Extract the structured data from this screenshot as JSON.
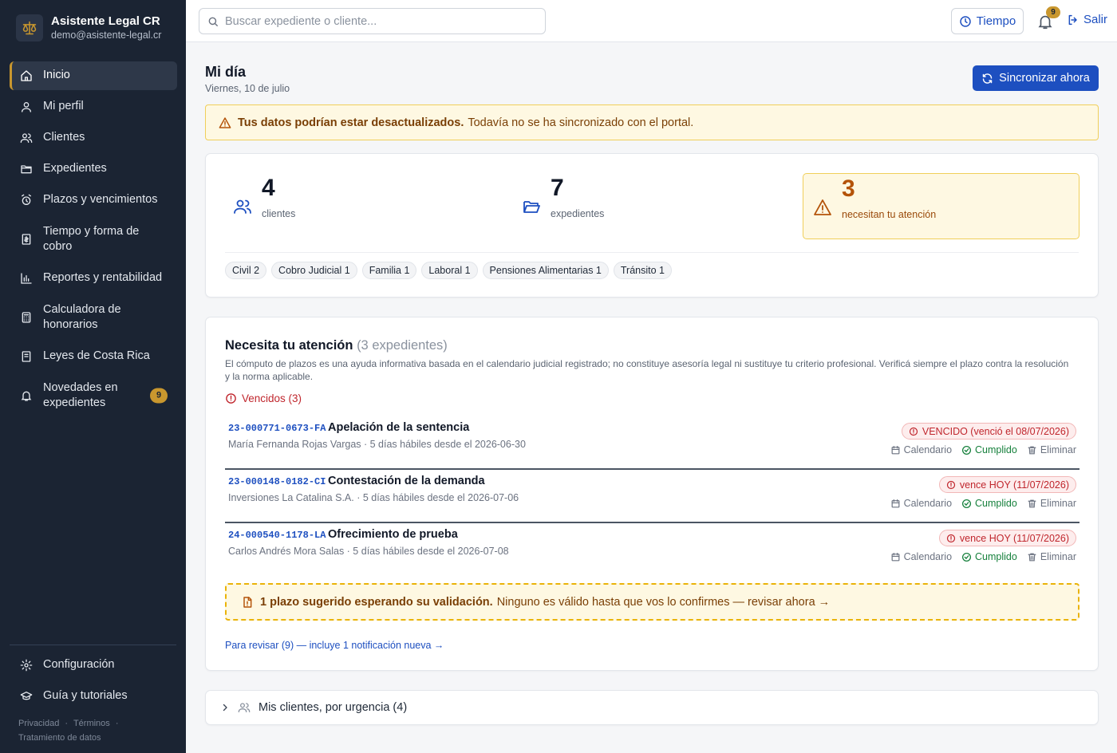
{
  "app": {
    "name": "Asistente Legal CR",
    "email": "demo@asistente-legal.cr",
    "accent": "#c9972e",
    "sidebar_bg": "#1b2433",
    "primary": "#1d4fc0"
  },
  "sidebar": {
    "items": [
      {
        "label": "Inicio",
        "icon": "home-icon",
        "active": true
      },
      {
        "label": "Mi perfil",
        "icon": "user-icon"
      },
      {
        "label": "Clientes",
        "icon": "users-icon"
      },
      {
        "label": "Expedientes",
        "icon": "folder-icon"
      },
      {
        "label": "Plazos y vencimientos",
        "icon": "alarm-clock-icon"
      },
      {
        "label": "Tiempo y forma de cobro",
        "icon": "receipt-icon"
      },
      {
        "label": "Reportes y rentabilidad",
        "icon": "bar-chart-icon"
      },
      {
        "label": "Calculadora de honorarios",
        "icon": "calculator-icon"
      },
      {
        "label": "Leyes de Costa Rica",
        "icon": "book-icon"
      },
      {
        "label": "Novedades en expedientes",
        "icon": "bell-icon",
        "badge": "9"
      }
    ],
    "bottom": [
      {
        "label": "Configuración",
        "icon": "gear-icon"
      },
      {
        "label": "Guía y tutoriales",
        "icon": "graduation-cap-icon"
      }
    ],
    "legal": [
      "Privacidad",
      "·",
      "Términos",
      "·",
      "Tratamiento de datos"
    ]
  },
  "topbar": {
    "search_placeholder": "Buscar expediente o cliente...",
    "time_label": "Tiempo",
    "notif_count": "9",
    "logout_label": "Salir"
  },
  "page": {
    "title": "Mi día",
    "date": "Viernes, 10 de julio",
    "sync_label": "Sincronizar ahora"
  },
  "alert": {
    "strong": "Tus datos podrían estar desactualizados.",
    "text": "Todavía no se ha sincronizado con el portal."
  },
  "stats": {
    "clients": {
      "value": "4",
      "label": "clientes"
    },
    "cases": {
      "value": "7",
      "label": "expedientes"
    },
    "attention": {
      "value": "3",
      "label": "necesitan tu atención"
    }
  },
  "chips": [
    "Civil 2",
    "Cobro Judicial 1",
    "Familia 1",
    "Laboral 1",
    "Pensiones Alimentarias 1",
    "Tránsito 1"
  ],
  "attention": {
    "title": "Necesita tu atención",
    "count": "(3 expedientes)",
    "disclaimer": "El cómputo de plazos es una ayuda informativa basada en el calendario judicial registrado; no constituye asesoría legal ni sustituye tu criterio profesional. Verificá siempre el plazo contra la resolución y la norma aplicable.",
    "section": "Vencidos (3)",
    "rows": [
      {
        "code": "23-000771-0673-FA",
        "title": "Apelación de la sentencia",
        "sub": "María Fernanda Rojas Vargas · 5 días hábiles desde el 2026-06-30",
        "badge": "VENCIDO (venció el 08/07/2026)"
      },
      {
        "code": "23-000148-0182-CI",
        "title": "Contestación de la demanda",
        "sub": "Inversiones La Catalina S.A. · 5 días hábiles desde el 2026-07-06",
        "badge": "vence HOY (11/07/2026)"
      },
      {
        "code": "24-000540-1178-LA",
        "title": "Ofrecimiento de prueba",
        "sub": "Carlos Andrés Mora Salas · 5 días hábiles desde el 2026-07-08",
        "badge": "vence HOY (11/07/2026)"
      }
    ],
    "actions": {
      "calendar": "Calendario",
      "done": "Cumplido",
      "delete": "Eliminar"
    },
    "pending_strong": "1 plazo sugerido esperando su validación.",
    "pending_text": "Ninguno es válido hasta que vos lo confirmes — revisar ahora →",
    "review_link": "Para revisar (9) — incluye 1 notificación nueva →"
  },
  "clients_section": {
    "label": "Mis clientes, por urgencia (4)"
  }
}
